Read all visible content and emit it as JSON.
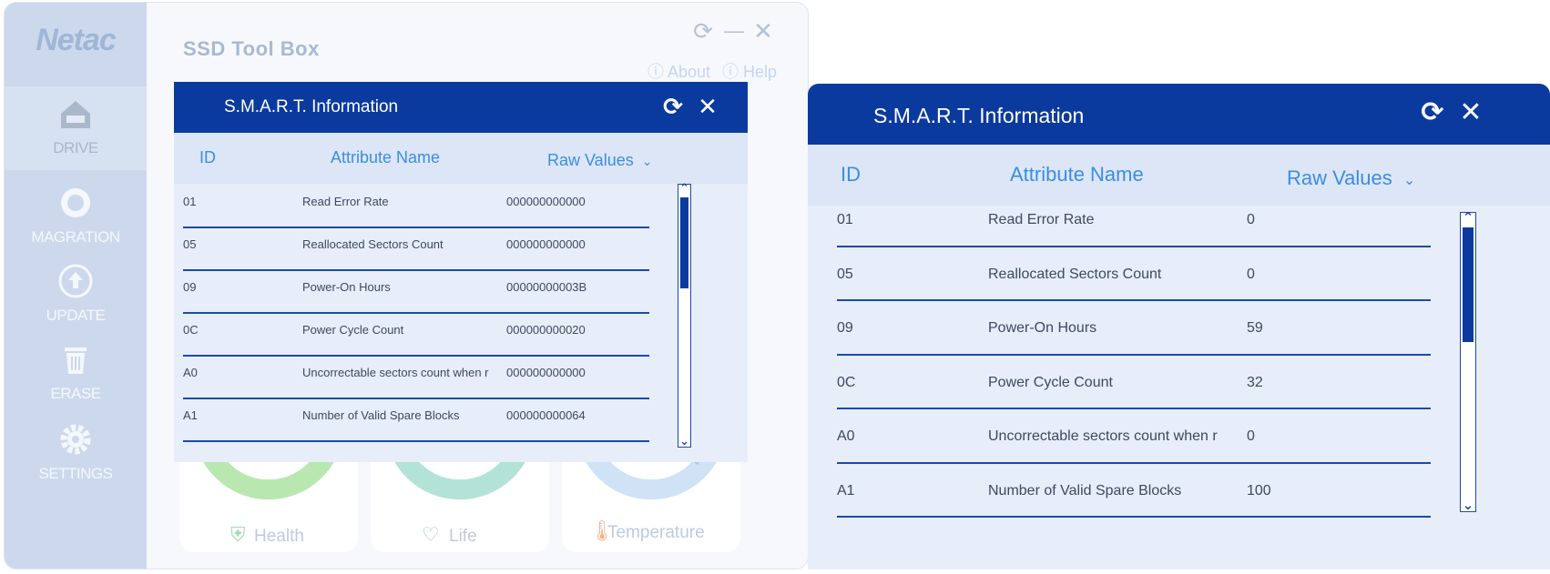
{
  "app": {
    "logo": "Netac",
    "title": "SSD Tool Box",
    "about_label": "About",
    "help_label": "Help",
    "nav": [
      {
        "label": "DRIVE",
        "icon": "home-icon"
      },
      {
        "label": "MAGRATION",
        "icon": "migration-icon"
      },
      {
        "label": "UPDATE",
        "icon": "upload-icon"
      },
      {
        "label": "ERASE",
        "icon": "trash-icon"
      },
      {
        "label": "SETTINGS",
        "icon": "gear-icon"
      }
    ],
    "cards": [
      {
        "label": "Health",
        "icon": "shield-icon",
        "color": "#b9e7b0"
      },
      {
        "label": "Life",
        "icon": "heart-icon",
        "color": "#b3e3d6"
      },
      {
        "label": "Temperature",
        "icon": "thermometer-icon",
        "color": "#cfe2f6"
      }
    ]
  },
  "smart_small": {
    "title": "S.M.A.R.T. Information",
    "columns": {
      "id": "ID",
      "name": "Attribute Name",
      "raw": "Raw Values"
    },
    "rows": [
      {
        "id": "01",
        "name": "Read Error Rate",
        "raw": "000000000000"
      },
      {
        "id": "05",
        "name": "Reallocated Sectors Count",
        "raw": "000000000000"
      },
      {
        "id": "09",
        "name": "Power-On Hours",
        "raw": "00000000003B"
      },
      {
        "id": "0C",
        "name": "Power Cycle Count",
        "raw": "000000000020"
      },
      {
        "id": "A0",
        "name": "Uncorrectable sectors count when r",
        "raw": "000000000000"
      },
      {
        "id": "A1",
        "name": "Number of Valid Spare Blocks",
        "raw": "000000000064"
      }
    ]
  },
  "smart_large": {
    "title": "S.M.A.R.T. Information",
    "columns": {
      "id": "ID",
      "name": "Attribute Name",
      "raw": "Raw Values"
    },
    "rows": [
      {
        "id": "01",
        "name": "Read Error Rate",
        "raw": "0"
      },
      {
        "id": "05",
        "name": "Reallocated Sectors Count",
        "raw": "0"
      },
      {
        "id": "09",
        "name": "Power-On Hours",
        "raw": "59"
      },
      {
        "id": "0C",
        "name": "Power Cycle Count",
        "raw": "32"
      },
      {
        "id": "A0",
        "name": "Uncorrectable sectors count when r",
        "raw": "0"
      },
      {
        "id": "A1",
        "name": "Number of Valid Spare Blocks",
        "raw": "100"
      }
    ]
  },
  "colors": {
    "header": "#0b3a9f",
    "column_text": "#3a8ee6",
    "separator": "#1b4aa8"
  }
}
